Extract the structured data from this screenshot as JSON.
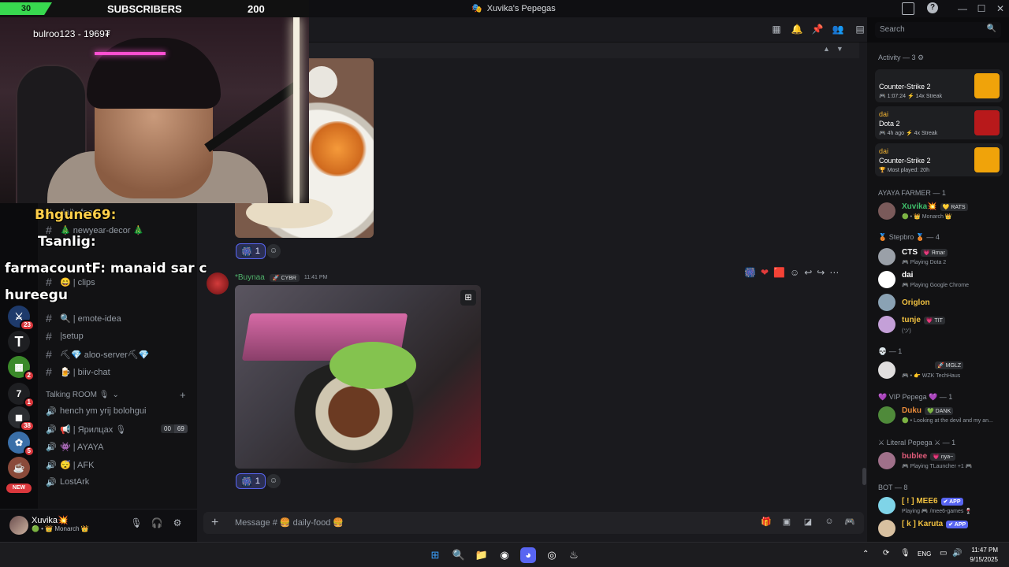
{
  "window": {
    "title": "Xuvika's Pepegas",
    "controls": [
      "—",
      "☐",
      "✕"
    ]
  },
  "stream_overlay": {
    "sub_count_left": "30",
    "sub_label": "SUBSCRIBERS",
    "sub_goal": "200",
    "cam_user": "bulroo123 - 1969₮",
    "chat_lines": [
      "Bhgune69:",
      "Tsanlig:",
      "farmacountF:  manaid sar c",
      "hureegu"
    ]
  },
  "server_rail": {
    "badges": [
      "23",
      "2",
      "1",
      "38",
      "5"
    ],
    "new_label": "NEW"
  },
  "channels": {
    "items": [
      {
        "prefix": "#",
        "label": "daily-food"
      },
      {
        "prefix": "#",
        "label": "🎄 newyear-decor 🎄"
      },
      {
        "prefix": "#",
        "label": "😄 | clips"
      },
      {
        "prefix": "#",
        "label": "🔍 | emote-idea"
      },
      {
        "prefix": "#",
        "label": "|setup"
      },
      {
        "prefix": "#",
        "label": "⛏💎 aloo-server⛏💎"
      },
      {
        "prefix": "#",
        "label": "🍺 | biiv-chat"
      }
    ],
    "category": "Talking ROOM 🎙",
    "voice": [
      {
        "label": "hench ym yrij bolohgui"
      },
      {
        "label": "📢 | Ярилцах 🎙",
        "count_a": "00",
        "count_b": "69"
      },
      {
        "label": "👾 | AYAYA"
      },
      {
        "label": "😴 | AFK"
      },
      {
        "label": "LostArk"
      }
    ]
  },
  "user_panel": {
    "name": "Xuvika💥",
    "status": "🟢 • 👑 Monarch 👑"
  },
  "toolbar": {
    "search_placeholder": "Search"
  },
  "messages": {
    "first_reaction_count": "1",
    "second": {
      "author": "*Buynaa",
      "tag": "🚀 CYBR",
      "time": "11:41 PM"
    },
    "second_reaction_count": "1"
  },
  "composer": {
    "placeholder": "Message # 🍔 daily-food 🍔"
  },
  "members": {
    "activity_header": "Activity — 3 ⚙",
    "activities": [
      {
        "user": "",
        "game": "Counter-Strike 2",
        "meta": "🎮 1:07:24  ⚡ 14x Streak",
        "color": "#f0a30a"
      },
      {
        "user": "dai",
        "game": "Dota 2",
        "meta": "🎮 4h ago  ⚡ 4x Streak",
        "color": "#b8191b"
      },
      {
        "user": "dai",
        "game": "Counter-Strike 2",
        "meta": "🏆 Most played: 20h",
        "color": "#f0a30a"
      }
    ],
    "groups": [
      {
        "header": "AYAYA FARMER — 1",
        "members": [
          {
            "name": "Xuvika💥",
            "tag": "💛 RATS",
            "status": "🟢 • 👑 Monarch 👑",
            "color": "#3fbf6a"
          }
        ]
      },
      {
        "header": "🥉 Stepbro 🥉 — 4",
        "members": [
          {
            "name": "CTS",
            "tag": "💗 Яmar",
            "status": "🎮 Playing Dota 2",
            "color": "#ffffff"
          },
          {
            "name": "dai",
            "tag": "",
            "status": "🎮 Playing Google Chrome",
            "color": "#ffffff"
          },
          {
            "name": "Origlon",
            "tag": "",
            "status": "",
            "color": "#f0c040"
          },
          {
            "name": "tunje",
            "tag": "💗 TIT",
            "status": "(ツ)",
            "color": "#f0c040"
          }
        ]
      },
      {
        "header": "💀 — 1",
        "members": [
          {
            "name": "",
            "tag": "🚀 MGLZ",
            "status": "🎮 • 👉 WZK TechHaus",
            "color": "#ffffff"
          }
        ]
      },
      {
        "header": "💜 VIP Pepega 💜 — 1",
        "members": [
          {
            "name": "Duku",
            "tag": "💚 DANK",
            "status": "🟢 • Looking at the devil and my an...",
            "color": "#e88a3a"
          }
        ]
      },
      {
        "header": "⚔ Literal Pepega ⚔ — 1",
        "members": [
          {
            "name": "bublee",
            "tag": "💗 nya~",
            "status": "🎮 Playing TLauncher +1 🎮",
            "color": "#e05b7a"
          }
        ]
      },
      {
        "header": "BOT — 8",
        "members": [
          {
            "name": "[ ! ] MEE6",
            "tag": "✔ APP",
            "status": "Playing 🎮 /mee6-games 🍷",
            "color": "#f0c040"
          },
          {
            "name": "[ k ] Karuta",
            "tag": "✔ APP",
            "status": "",
            "color": "#f0c040"
          }
        ]
      }
    ]
  },
  "taskbar": {
    "lang": "ENG",
    "time": "11:47 PM",
    "date": "9/15/2025"
  },
  "colors": {
    "accent": "#5865f2",
    "sub_green": "#38d84f",
    "bg": "#1a1a1e"
  }
}
